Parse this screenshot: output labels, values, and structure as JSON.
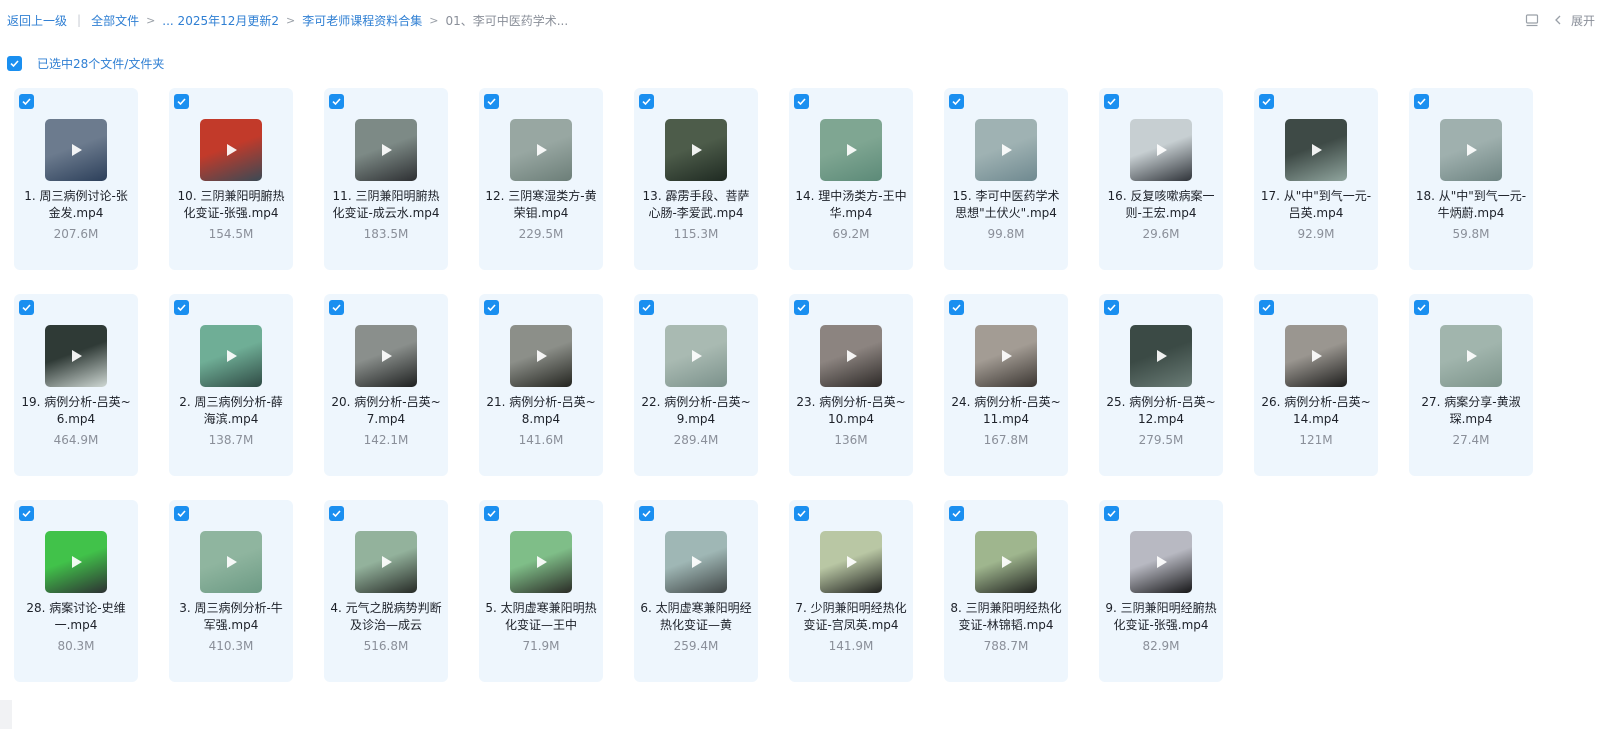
{
  "breadcrumb": {
    "back": "返回上一级",
    "all_files": "全部文件",
    "ellipsis_item": "... 2025年12月更新2",
    "course": "李可老师课程资料合集",
    "current": "01、李可中医药学术..."
  },
  "toolbar": {
    "expand_label": "展开",
    "icons": [
      "panel-icon",
      "chevron-left-icon"
    ]
  },
  "selection": {
    "label": "已选中28个文件/文件夹"
  },
  "colors": {
    "accent": "#1a8ff0",
    "link": "#2f7fd3",
    "card_bg": "#eef6fd"
  },
  "files": [
    {
      "name": "1. 周三病例讨论-张金发.mp4",
      "size": "207.6M",
      "thumb": [
        "#6c7b8e",
        "#2c3f5a"
      ]
    },
    {
      "name": "10. 三阴兼阳明腑热化变证-张强.mp4",
      "size": "154.5M",
      "thumb": [
        "#c23a2a",
        "#3a4a55"
      ]
    },
    {
      "name": "11. 三阴兼阳明腑热化变证-成云水.mp4",
      "size": "183.5M",
      "thumb": [
        "#7d8a86",
        "#2d2f32"
      ]
    },
    {
      "name": "12. 三阴寒湿类方-黄荣钼.mp4",
      "size": "229.5M",
      "thumb": [
        "#98a7a2",
        "#6c7e78"
      ]
    },
    {
      "name": "13. 霹雳手段、菩萨心肠-李爱武.mp4",
      "size": "115.3M",
      "thumb": [
        "#4d5c4a",
        "#1f2a22"
      ]
    },
    {
      "name": "14. 理中汤类方-王中华.mp4",
      "size": "69.2M",
      "thumb": [
        "#7fa692",
        "#5c8a78"
      ]
    },
    {
      "name": "15. 李可中医药学术思想\"土伏火\".mp4",
      "size": "99.8M",
      "thumb": [
        "#9fb2b3",
        "#6f8990"
      ]
    },
    {
      "name": "16. 反复咳嗽病案一则-王宏.mp4",
      "size": "29.6M",
      "thumb": [
        "#c7cfd2",
        "#2f3339"
      ]
    },
    {
      "name": "17. 从\"中\"到气一元-吕英.mp4",
      "size": "92.9M",
      "thumb": [
        "#3e4a46",
        "#90a59e"
      ]
    },
    {
      "name": "18. 从\"中\"到气一元-牛炳蔚.mp4",
      "size": "59.8M",
      "thumb": [
        "#9fb0ae",
        "#6e8482"
      ]
    },
    {
      "name": "19. 病例分析-吕英~6.mp4",
      "size": "464.9M",
      "thumb": [
        "#2f3a36",
        "#cfd8d4"
      ]
    },
    {
      "name": "2. 周三病例分析-薛海滨.mp4",
      "size": "138.7M",
      "thumb": [
        "#6fae96",
        "#2f4a44"
      ]
    },
    {
      "name": "20. 病例分析-吕英~7.mp4",
      "size": "142.1M",
      "thumb": [
        "#8a8f8c",
        "#1e2020"
      ]
    },
    {
      "name": "21. 病例分析-吕英~8.mp4",
      "size": "141.6M",
      "thumb": [
        "#8c8f89",
        "#23241f"
      ]
    },
    {
      "name": "22. 病例分析-吕英~9.mp4",
      "size": "289.4M",
      "thumb": [
        "#a9bab2",
        "#7b918b"
      ]
    },
    {
      "name": "23. 病例分析-吕英~10.mp4",
      "size": "136M",
      "thumb": [
        "#8c8480",
        "#2d2927"
      ]
    },
    {
      "name": "24. 病例分析-吕英~11.mp4",
      "size": "167.8M",
      "thumb": [
        "#a39c94",
        "#3a3531"
      ]
    },
    {
      "name": "25. 病例分析-吕英~12.mp4",
      "size": "279.5M",
      "thumb": [
        "#3b4a45",
        "#6a7c76"
      ]
    },
    {
      "name": "26. 病例分析-吕英~14.mp4",
      "size": "121M",
      "thumb": [
        "#9a9690",
        "#1d1d1c"
      ]
    },
    {
      "name": "27. 病案分享-黄淑琛.mp4",
      "size": "27.4M",
      "thumb": [
        "#a1b5ad",
        "#7d948b"
      ]
    },
    {
      "name": "28. 病案讨论-史维一.mp4",
      "size": "80.3M",
      "thumb": [
        "#41c24a",
        "#2d3033"
      ]
    },
    {
      "name": "3. 周三病例分析-牛军强.mp4",
      "size": "410.3M",
      "thumb": [
        "#8fb59f",
        "#6c9a84"
      ]
    },
    {
      "name": "4. 元气之脱病势判断及诊治—成云",
      "size": "516.8M",
      "thumb": [
        "#93b29c",
        "#262a26"
      ]
    },
    {
      "name": "5. 太阴虚寒兼阳明热化变证—王中",
      "size": "71.9M",
      "thumb": [
        "#7fbe88",
        "#2a2b26"
      ]
    },
    {
      "name": "6. 太阴虚寒兼阳明经热化变证—黄",
      "size": "259.4M",
      "thumb": [
        "#9fb7b5",
        "#3f4545"
      ]
    },
    {
      "name": "7. 少阴兼阳明经热化变证-宫凤英.mp4",
      "size": "141.9M",
      "thumb": [
        "#b9c7a4",
        "#1e1f1d"
      ]
    },
    {
      "name": "8. 三阴兼阳明经热化变证-林锦韬.mp4",
      "size": "788.7M",
      "thumb": [
        "#9fb68e",
        "#1f211e"
      ]
    },
    {
      "name": "9. 三阴兼阳明经腑热化变证-张强.mp4",
      "size": "82.9M",
      "thumb": [
        "#b8b9c2",
        "#161618"
      ]
    }
  ]
}
